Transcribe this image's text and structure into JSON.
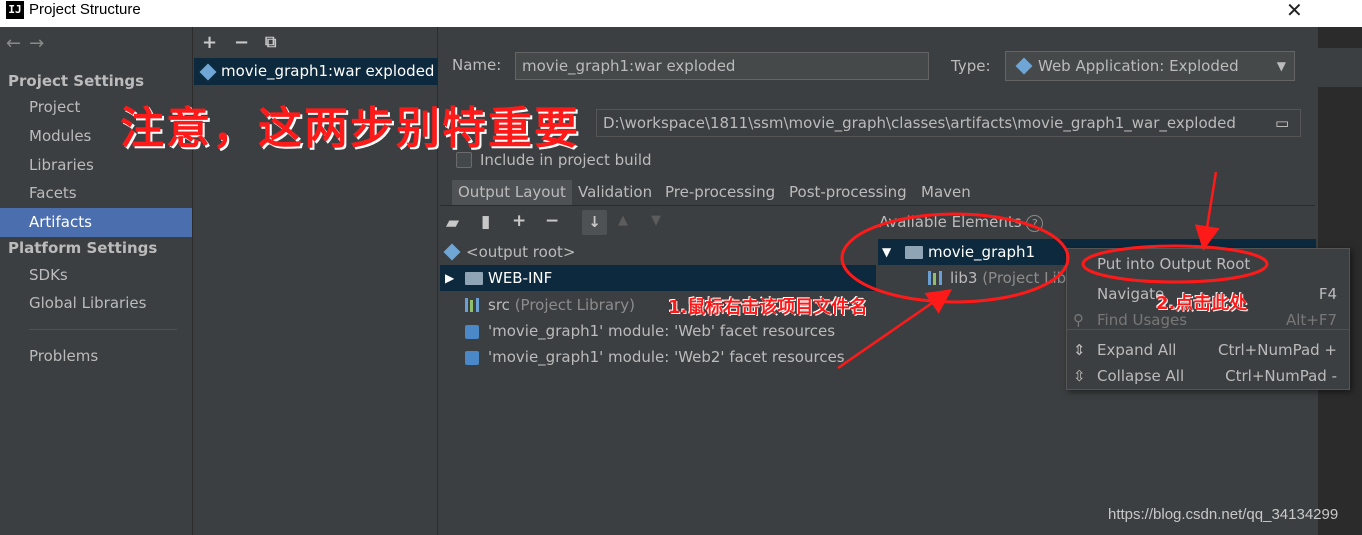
{
  "window": {
    "title": "Project Structure",
    "app_icon": "IJ",
    "close_icon": "close-icon"
  },
  "sidebar": {
    "nav_back": "←",
    "nav_forward": "→",
    "project_settings_header": "Project Settings",
    "project_items": [
      "Project",
      "Modules",
      "Libraries",
      "Facets",
      "Artifacts"
    ],
    "selected_item": "Artifacts",
    "platform_settings_header": "Platform Settings",
    "platform_items": [
      "SDKs",
      "Global Libraries"
    ],
    "problems": "Problems"
  },
  "artifacts": {
    "toolbar": {
      "add": "+",
      "remove": "−",
      "copy": "⧉"
    },
    "items": [
      "movie_graph1:war exploded"
    ]
  },
  "details": {
    "name_label": "Name:",
    "name_value": "movie_graph1:war exploded",
    "type_label": "Type:",
    "type_value": "Web Application: Exploded",
    "output_path": "D:\\workspace\\1811\\ssm\\movie_graph\\classes\\artifacts\\movie_graph1_war_exploded",
    "include_build_label": "Include in project build",
    "include_build_checked": false,
    "tabs": [
      "Output Layout",
      "Validation",
      "Pre-processing",
      "Post-processing",
      "Maven"
    ],
    "selected_tab": "Output Layout"
  },
  "output_tree": [
    {
      "label": "<output root>",
      "note": ""
    },
    {
      "label": "WEB-INF",
      "note": ""
    },
    {
      "label": "src",
      "note": "(Project Library)"
    },
    {
      "label": "'movie_graph1' module: 'Web' facet resources",
      "note": ""
    },
    {
      "label": "'movie_graph1' module: 'Web2' facet resources",
      "note": ""
    }
  ],
  "available": {
    "header": "Available Elements",
    "help": "?",
    "root": "movie_graph1",
    "child": "lib3",
    "child_note": "(Project Libr"
  },
  "context_menu": {
    "items": [
      {
        "label": "Put into Output Root",
        "shortcut": ""
      },
      {
        "label": "Navigate",
        "shortcut": "F4"
      },
      {
        "label": "Find Usages",
        "shortcut": "Alt+F7"
      },
      {
        "label": "Expand All",
        "shortcut": "Ctrl+NumPad +"
      },
      {
        "label": "Collapse All",
        "shortcut": "Ctrl+NumPad -"
      }
    ]
  },
  "annotations": {
    "headline": "注意，这两步别特重要",
    "step1": "1.鼠标右击该项目文件名",
    "step2": "2.点击此处",
    "color": "#ff1a1a"
  },
  "watermark": "https://blog.csdn.net/qq_34134299"
}
